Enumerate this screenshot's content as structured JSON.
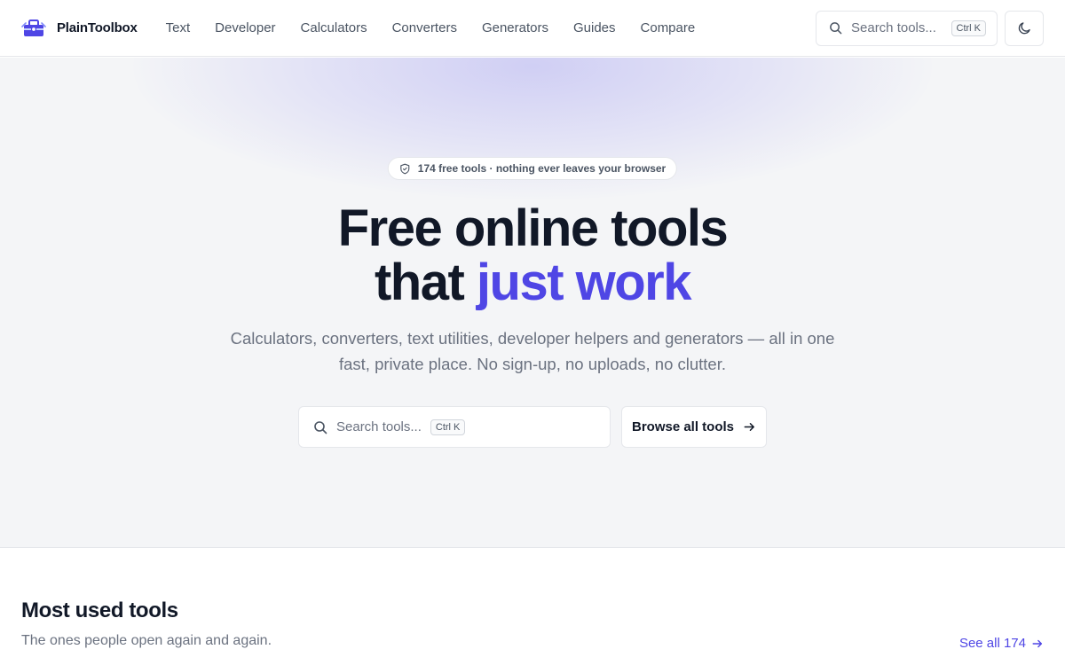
{
  "header": {
    "brand": "PlainToolbox",
    "nav": [
      "Text",
      "Developer",
      "Calculators",
      "Converters",
      "Generators",
      "Guides",
      "Compare"
    ],
    "search": {
      "placeholder": "Search tools...",
      "shortcut": "Ctrl K"
    },
    "theme_icon": "moon-icon"
  },
  "hero": {
    "badge": {
      "icon": "shield-icon",
      "text": "174 free tools · nothing ever leaves your browser"
    },
    "headline_line1": "Free online tools",
    "headline_line2_prefix": "that ",
    "headline_line2_accent": "just work",
    "subtitle": "Calculators, converters, text utilities, developer helpers and generators — all in one fast, private place. No sign-up, no uploads, no clutter.",
    "search": {
      "placeholder": "Search tools...",
      "shortcut": "Ctrl K"
    },
    "browse_button": "Browse all tools"
  },
  "most_used": {
    "title": "Most used tools",
    "subtitle": "The ones people open again and again.",
    "see_all": "See all 174"
  },
  "colors": {
    "accent": "#4f46e5",
    "text": "#111827",
    "muted": "#6b7280",
    "hero_bg": "#f4f5f7",
    "border": "#e5e7eb"
  }
}
